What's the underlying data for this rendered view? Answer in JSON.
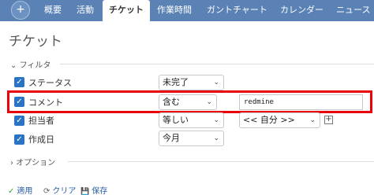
{
  "topnav": {
    "plus": "+",
    "tabs": [
      "概要",
      "活動",
      "チケット",
      "作業時間",
      "ガントチャート",
      "カレンダー",
      "ニュース"
    ],
    "active_tab": "チケット"
  },
  "page_title": "チケット",
  "filter": {
    "legend": "フィルタ",
    "legend_arrow": "⌄",
    "rows": [
      {
        "label": "ステータス",
        "checked": true,
        "operator": "未完了"
      },
      {
        "label": "コメント",
        "checked": true,
        "operator": "含む",
        "value": "redmine"
      },
      {
        "label": "担当者",
        "checked": true,
        "operator": "等しい",
        "value_select": "<< 自分 >>"
      },
      {
        "label": "作成日",
        "checked": true,
        "operator": "今月"
      }
    ]
  },
  "options": {
    "legend": "オプション",
    "legend_arrow": "›"
  },
  "actions": {
    "apply": "適用",
    "apply_icon": "✓",
    "clear": "クリア",
    "clear_icon": "⟳",
    "save": "保存",
    "save_icon": "💾"
  },
  "colors": {
    "nav": "#5b82b5",
    "highlight": "#e8000b",
    "checkbox": "#2a73c5",
    "link": "#2a5fa4"
  }
}
